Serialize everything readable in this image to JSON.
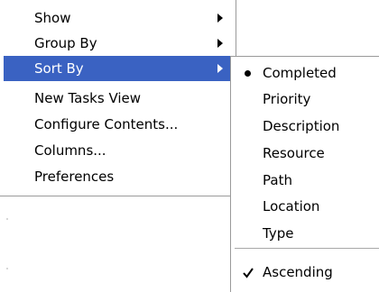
{
  "main_menu": {
    "items": [
      {
        "label": "Show",
        "has_submenu": true
      },
      {
        "label": "Group By",
        "has_submenu": true
      },
      {
        "label": "Sort By",
        "has_submenu": true,
        "highlighted": true
      },
      {
        "label": "New Tasks View"
      },
      {
        "label": "Configure Contents..."
      },
      {
        "label": "Columns..."
      },
      {
        "label": "Preferences"
      }
    ]
  },
  "sort_submenu": {
    "items": [
      {
        "label": "Completed",
        "selected": true,
        "indicator": "radio-bullet-icon"
      },
      {
        "label": "Priority"
      },
      {
        "label": "Description"
      },
      {
        "label": "Resource"
      },
      {
        "label": "Path"
      },
      {
        "label": "Location"
      },
      {
        "label": "Type"
      }
    ],
    "order_option": {
      "label": "Ascending",
      "checked": true,
      "indicator": "checkmark-icon"
    }
  },
  "colors": {
    "highlight": "#3a62c2",
    "highlight_text": "#ffffff",
    "border": "#9a9a9a"
  }
}
